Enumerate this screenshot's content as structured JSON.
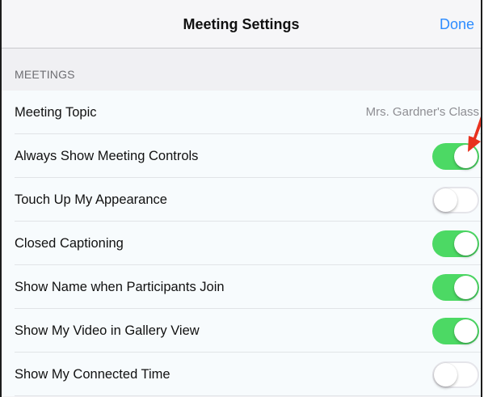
{
  "header": {
    "title": "Meeting Settings",
    "done_label": "Done"
  },
  "section": {
    "title": "MEETINGS"
  },
  "rows": [
    {
      "label": "Meeting Topic",
      "value": "Mrs. Gardner's Class"
    },
    {
      "label": "Always Show Meeting Controls",
      "toggle": true
    },
    {
      "label": "Touch Up My Appearance",
      "toggle": false
    },
    {
      "label": "Closed Captioning",
      "toggle": true
    },
    {
      "label": "Show Name when Participants Join",
      "toggle": true
    },
    {
      "label": "Show My Video in Gallery View",
      "toggle": true
    },
    {
      "label": "Show My Connected Time",
      "toggle": false
    }
  ],
  "colors": {
    "accent": "#2d8cff",
    "toggle_on": "#4cd964",
    "annotation_arrow": "#e8321f"
  },
  "icons": {
    "annotation": "red-arrow-icon"
  }
}
